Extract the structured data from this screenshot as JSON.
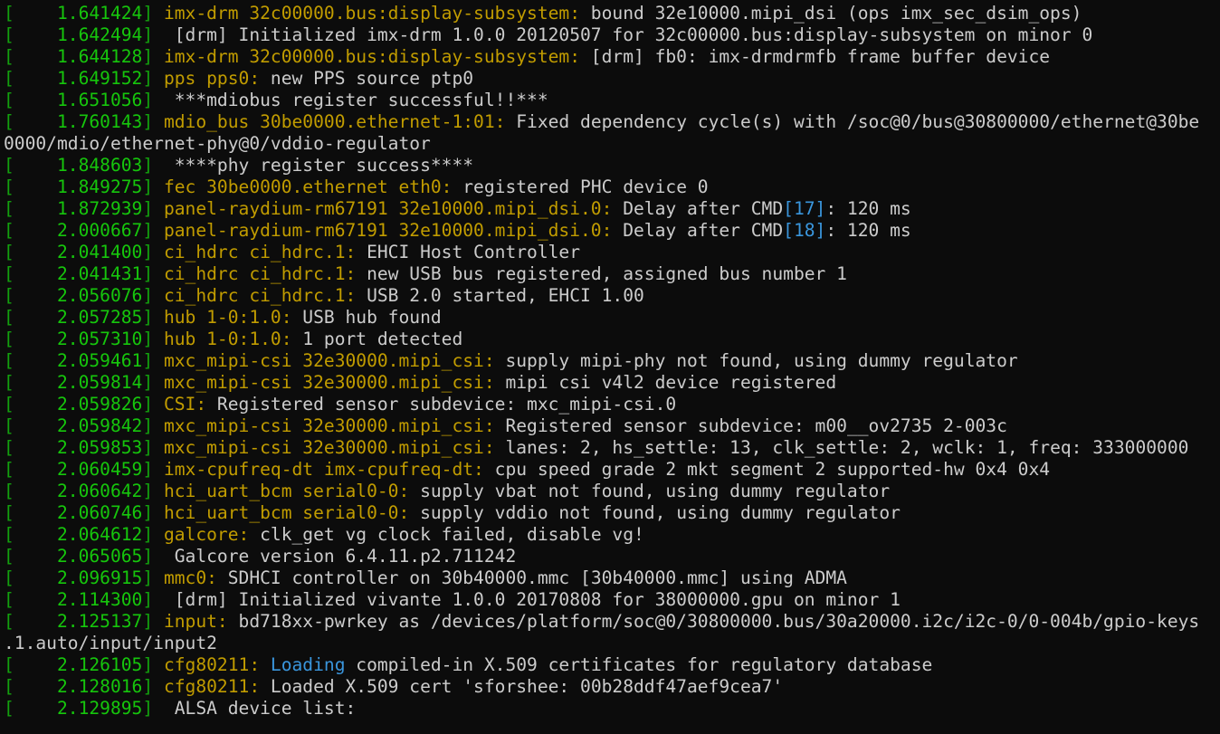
{
  "colors": {
    "background": "#0c0c0c",
    "foreground": "#cccccc",
    "bracket": "#13a10e",
    "timestamp": "#16c60c",
    "source": "#c19c00",
    "highlight": "#3a96dd"
  },
  "lines": [
    {
      "ts": "1.641424",
      "src": "imx-drm 32c00000.bus:display-subsystem:",
      "msg": " bound 32e10000.mipi_dsi (ops imx_sec_dsim_ops)"
    },
    {
      "ts": "1.642494",
      "src": "",
      "msg": " [drm] Initialized imx-drm 1.0.0 20120507 for 32c00000.bus:display-subsystem on minor 0"
    },
    {
      "ts": "1.644128",
      "src": "imx-drm 32c00000.bus:display-subsystem:",
      "msg": " [drm] fb0: imx-drmdrmfb frame buffer device"
    },
    {
      "ts": "1.649152",
      "src": "pps pps0:",
      "msg": " new PPS source ptp0"
    },
    {
      "ts": "1.651056",
      "src": "",
      "msg": " ***mdiobus register successful!!***"
    },
    {
      "ts": "1.760143",
      "src": "mdio_bus 30be0000.ethernet-1:01:",
      "msg": " Fixed dependency cycle(s) with /soc@0/bus@30800000/ethernet@30be"
    },
    {
      "wrap": "0000/mdio/ethernet-phy@0/vddio-regulator"
    },
    {
      "ts": "1.848603",
      "src": "",
      "msg": " ****phy register success****"
    },
    {
      "ts": "1.849275",
      "src": "fec 30be0000.ethernet eth0:",
      "msg": " registered PHC device 0"
    },
    {
      "ts": "1.872939",
      "src": "panel-raydium-rm67191 32e10000.mipi_dsi.0:",
      "msg": " Delay after CMD",
      "hl": "[17]",
      "msg2": ": 120 ms"
    },
    {
      "ts": "2.000667",
      "src": "panel-raydium-rm67191 32e10000.mipi_dsi.0:",
      "msg": " Delay after CMD",
      "hl": "[18]",
      "msg2": ": 120 ms"
    },
    {
      "ts": "2.041400",
      "src": "ci_hdrc ci_hdrc.1:",
      "msg": " EHCI Host Controller"
    },
    {
      "ts": "2.041431",
      "src": "ci_hdrc ci_hdrc.1:",
      "msg": " new USB bus registered, assigned bus number 1"
    },
    {
      "ts": "2.056076",
      "src": "ci_hdrc ci_hdrc.1:",
      "msg": " USB 2.0 started, EHCI 1.00"
    },
    {
      "ts": "2.057285",
      "src": "hub 1-0:1.0:",
      "msg": " USB hub found"
    },
    {
      "ts": "2.057310",
      "src": "hub 1-0:1.0:",
      "msg": " 1 port detected"
    },
    {
      "ts": "2.059461",
      "src": "mxc_mipi-csi 32e30000.mipi_csi:",
      "msg": " supply mipi-phy not found, using dummy regulator"
    },
    {
      "ts": "2.059814",
      "src": "mxc_mipi-csi 32e30000.mipi_csi:",
      "msg": " mipi csi v4l2 device registered"
    },
    {
      "ts": "2.059826",
      "src": "CSI:",
      "msg": " Registered sensor subdevice: mxc_mipi-csi.0"
    },
    {
      "ts": "2.059842",
      "src": "mxc_mipi-csi 32e30000.mipi_csi:",
      "msg": " Registered sensor subdevice: m00__ov2735 2-003c"
    },
    {
      "ts": "2.059853",
      "src": "mxc_mipi-csi 32e30000.mipi_csi:",
      "msg": " lanes: 2, hs_settle: 13, clk_settle: 2, wclk: 1, freq: 333000000"
    },
    {
      "ts": "2.060459",
      "src": "imx-cpufreq-dt imx-cpufreq-dt:",
      "msg": " cpu speed grade 2 mkt segment 2 supported-hw 0x4 0x4"
    },
    {
      "ts": "2.060642",
      "src": "hci_uart_bcm serial0-0:",
      "msg": " supply vbat not found, using dummy regulator"
    },
    {
      "ts": "2.060746",
      "src": "hci_uart_bcm serial0-0:",
      "msg": " supply vddio not found, using dummy regulator"
    },
    {
      "ts": "2.064612",
      "src": "galcore:",
      "msg": " clk_get vg clock failed, disable vg!"
    },
    {
      "ts": "2.065065",
      "src": "",
      "msg": " Galcore version 6.4.11.p2.711242"
    },
    {
      "ts": "2.096915",
      "src": "mmc0:",
      "msg": " SDHCI controller on 30b40000.mmc [30b40000.mmc] using ADMA"
    },
    {
      "ts": "2.114300",
      "src": "",
      "msg": " [drm] Initialized vivante 1.0.0 20170808 for 38000000.gpu on minor 1"
    },
    {
      "ts": "2.125137",
      "src": "input:",
      "msg": " bd718xx-pwrkey as /devices/platform/soc@0/30800000.bus/30a20000.i2c/i2c-0/0-004b/gpio-keys"
    },
    {
      "wrap": ".1.auto/input/input2"
    },
    {
      "ts": "2.126105",
      "src": "cfg80211:",
      "hl": " Loading",
      "msg2": " compiled-in X.509 certificates for regulatory database"
    },
    {
      "ts": "2.128016",
      "src": "cfg80211:",
      "msg": " Loaded X.509 cert 'sforshee: 00b28ddf47aef9cea7'"
    },
    {
      "ts": "2.129895",
      "src": "",
      "msg": " ALSA device list:"
    }
  ]
}
